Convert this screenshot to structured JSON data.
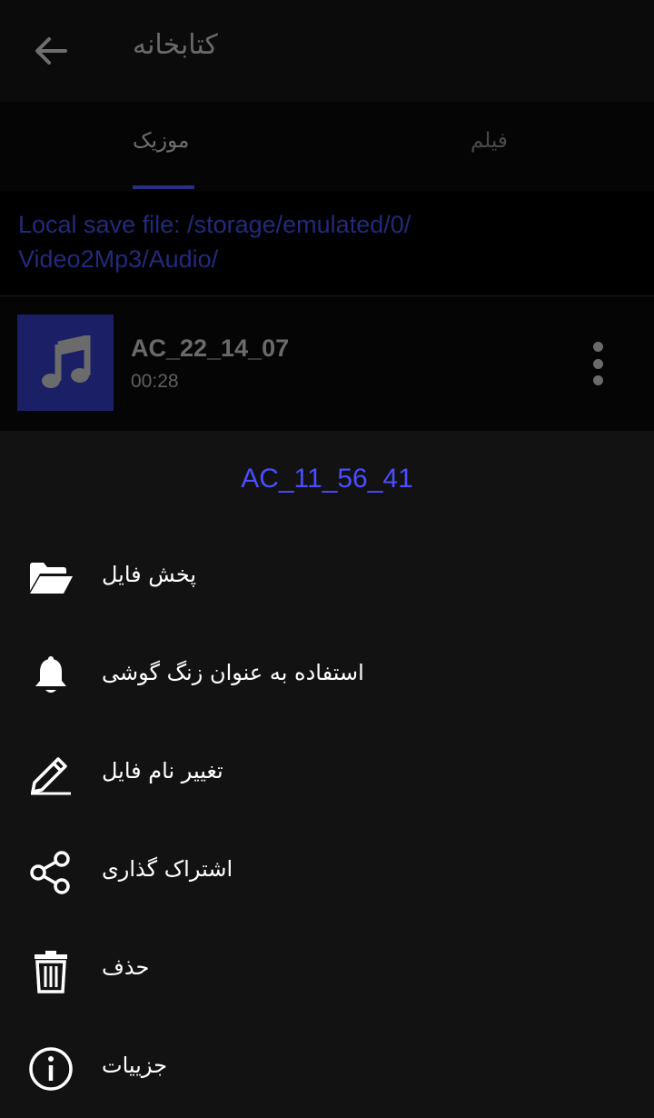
{
  "app": {
    "title": "کتابخانه",
    "back_icon": "arrow-left-icon"
  },
  "tabs": [
    {
      "label": "موزیک",
      "selected": true
    },
    {
      "label": "فیلم",
      "selected": false
    }
  ],
  "save_path": "Local save file: /storage/emulated/0/\nVideo2Mp3/Audio/",
  "track": {
    "name": "AC_22_14_07",
    "duration": "00:28",
    "thumb_icon": "music-note-icon",
    "more_icon": "more-vert-icon"
  },
  "sheet": {
    "title": "AC_11_56_41",
    "items": [
      {
        "label": "پخش فایل",
        "icon": "folder-open-icon"
      },
      {
        "label": "استفاده به عنوان زنگ گوشی",
        "icon": "bell-icon"
      },
      {
        "label": "تغییر نام فایل",
        "icon": "pencil-icon"
      },
      {
        "label": "اشتراک گذاری",
        "icon": "share-icon"
      },
      {
        "label": "حذف",
        "icon": "trash-icon"
      },
      {
        "label": "جزییات",
        "icon": "info-icon"
      }
    ]
  },
  "colors": {
    "accent": "#4b4dff",
    "thumb_bg": "#1b1f66",
    "sheet_bg": "#121212",
    "path_text": "#232a7a"
  }
}
